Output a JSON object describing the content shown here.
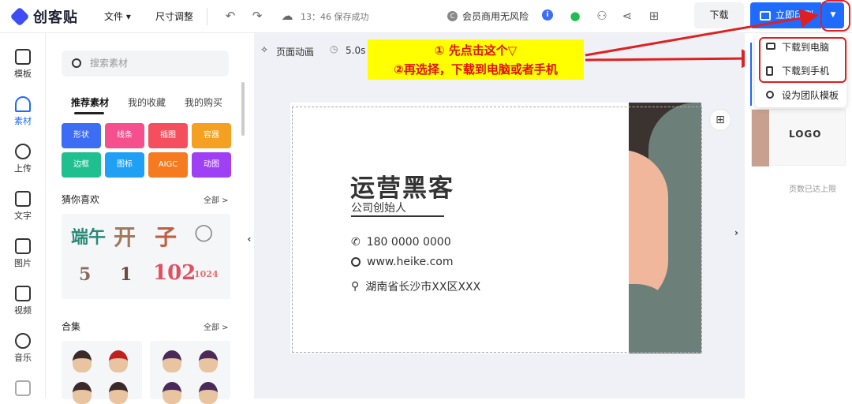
{
  "header": {
    "brand": "创客贴",
    "menu_file": "文件",
    "menu_resize": "尺寸调整",
    "save_time": "13：46 保存成功",
    "vip_text": "会员商用无风险",
    "download_label": "下载",
    "print_label": "立即印刷"
  },
  "sidebar": {
    "items": [
      {
        "label": "模板",
        "icon": "template-icon"
      },
      {
        "label": "素材",
        "icon": "material-icon"
      },
      {
        "label": "上传",
        "icon": "upload-icon"
      },
      {
        "label": "文字",
        "icon": "text-icon"
      },
      {
        "label": "图片",
        "icon": "image-icon"
      },
      {
        "label": "视频",
        "icon": "video-icon"
      },
      {
        "label": "音乐",
        "icon": "music-icon"
      }
    ]
  },
  "panel": {
    "search_placeholder": "搜索素材",
    "tabs": [
      "推荐素材",
      "我的收藏",
      "我的购买"
    ],
    "chips": [
      {
        "label": "形状",
        "color": "#3d6cf5"
      },
      {
        "label": "线条",
        "color": "#f54f8e"
      },
      {
        "label": "插图",
        "color": "#f54f5f"
      },
      {
        "label": "容器",
        "color": "#f5a020"
      },
      {
        "label": "边框",
        "color": "#1fbf8f"
      },
      {
        "label": "图标",
        "color": "#1fa0f5"
      },
      {
        "label": "AIGC",
        "color": "#f57a20"
      },
      {
        "label": "动图",
        "color": "#a040f5"
      }
    ],
    "guess_title": "猜你喜欢",
    "guess_all": "全部 >",
    "guess_glyphs": [
      "端午",
      "开",
      "子",
      "○",
      "5",
      "1",
      "102",
      "1024"
    ],
    "collection_title": "合集",
    "collection_all": "全部 >"
  },
  "canvas": {
    "page_animation": "页面动画",
    "duration": "5.0s",
    "annotation_line1": "① 先点击这个▽",
    "annotation_line2": "②再选择，下载到电脑或者手机",
    "card_name": "运营黑客",
    "card_title": "公司创始人",
    "card_phone": "180 0000 0000",
    "card_web": "www.heike.com",
    "card_address": "湖南省长沙市XX区XXX"
  },
  "dropdown": {
    "items": [
      "下载到电脑",
      "下载到手机",
      "设为团队模板"
    ]
  },
  "right_panel": {
    "thumb_logo": "LOGO",
    "page_limit": "页数已达上限"
  }
}
